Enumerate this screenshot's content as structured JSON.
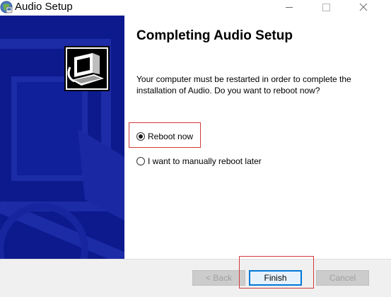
{
  "window": {
    "title": "Audio Setup",
    "icon": "setup-globe-icon",
    "controls": [
      "minimize-icon",
      "maximize-icon",
      "close-icon"
    ]
  },
  "main": {
    "heading": "Completing Audio Setup",
    "description": "Your computer must be restarted in order to complete the installation of Audio. Do you want to reboot now?",
    "options": [
      {
        "label": "Reboot now",
        "selected": true
      },
      {
        "label": "I want to manually reboot later",
        "selected": false
      }
    ]
  },
  "buttons": {
    "back": "< Back",
    "finish": "Finish",
    "cancel": "Cancel"
  },
  "colors": {
    "side_panel": "#0c1a8e",
    "highlight": "#d23b3b",
    "default_button_border": "#0078d7"
  }
}
